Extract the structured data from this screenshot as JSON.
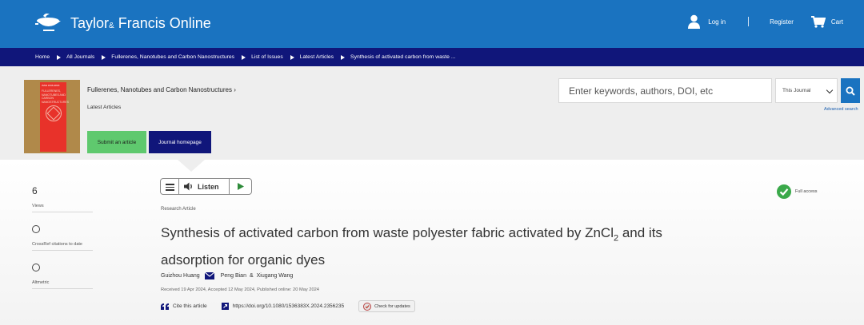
{
  "header": {
    "logo_text": "Taylor",
    "logo_amp": "&",
    "logo_text2": "Francis Online",
    "login_label": "Log in",
    "register_label": "Register",
    "cart_label": "Cart"
  },
  "breadcrumb": [
    "Home",
    "All Journals",
    "Fullerenes, Nanotubes and Carbon Nanostructures",
    "List of Issues",
    "Latest Articles",
    "Synthesis of activated carbon from waste ..."
  ],
  "journal": {
    "name": "Fullerenes, Nanotubes and Carbon Nanostructures",
    "name_chevron": "›",
    "latest_label": "Latest Articles",
    "submit_label": "Submit an article",
    "homepage_label": "Journal homepage",
    "cover_top": "ISSN 1536-383X",
    "cover_title": "FULLERENES, NANOTUBES AND CARBON NANOSTRUCTURES"
  },
  "search": {
    "placeholder": "Enter keywords, authors, DOI, etc",
    "scope_value": "This Journal",
    "advanced_label": "Advanced search"
  },
  "metrics": {
    "views_value": "6",
    "views_label": "Views",
    "crossref_label": "CrossRef citations to date",
    "altmetric_label": "Altmetric"
  },
  "listen": {
    "label": "Listen"
  },
  "access": {
    "label": "Full access"
  },
  "article": {
    "type": "Research Article",
    "title_part1": "Synthesis of activated carbon from waste polyester fabric activated by ZnCl",
    "title_sub": "2",
    "title_part2": " and its adsorption for organic dyes",
    "author1": "Guizhou Huang",
    "author2": "Peng Bian",
    "author_amp": "&",
    "author3": "Xiugang Wang",
    "dates": "Received 19 Apr 2024, Accepted 12 May 2024, Published online: 20 May 2024",
    "cite_label": "Cite this article",
    "doi": "https://doi.org/10.1080/1536383X.2024.2356235",
    "check_updates_label": "Check for updates"
  },
  "colors": {
    "header_blue": "#1a73c0",
    "breadcrumb_navy": "#10167a",
    "submit_green": "#5fc96e",
    "access_green": "#3aa94a"
  }
}
